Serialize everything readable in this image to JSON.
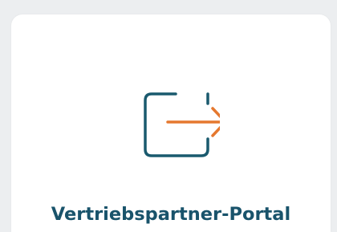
{
  "tile": {
    "label": "Vertriebspartner-Portal",
    "icon": "login-arrow-icon",
    "colors": {
      "frame": "#1a5a6e",
      "arrow": "#e5782f",
      "label": "#19536b"
    }
  }
}
